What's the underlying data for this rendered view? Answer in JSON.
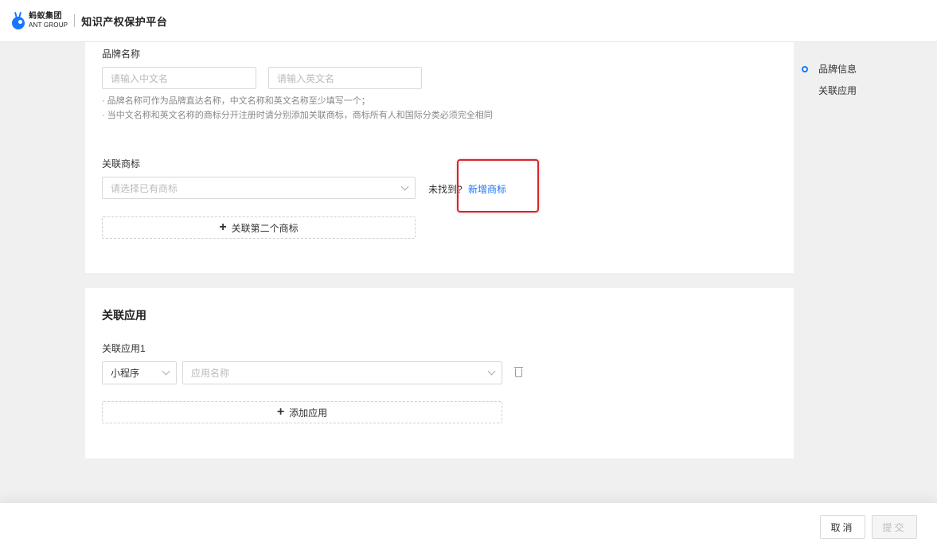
{
  "header": {
    "logo_cn": "蚂蚁集团",
    "logo_en": "ANT GROUP",
    "platform_title": "知识产权保护平台"
  },
  "brand": {
    "label": "品牌名称",
    "cn_placeholder": "请输入中文名",
    "en_placeholder": "请输入英文名",
    "hint1": "· 品牌名称可作为品牌直达名称，中文名称和英文名称至少填写一个；",
    "hint2": "· 当中文名称和英文名称的商标分开注册时请分别添加关联商标，商标所有人和国际分类必须完全相同"
  },
  "trademark": {
    "label": "关联商标",
    "select_placeholder": "请选择已有商标",
    "not_found": "未找到?",
    "add_new": "新增商标",
    "add_second": "关联第二个商标"
  },
  "apps": {
    "section_title": "关联应用",
    "app1_label": "关联应用1",
    "type_value": "小程序",
    "name_placeholder": "应用名称",
    "add_app": "添加应用"
  },
  "anchor": {
    "items": [
      "品牌信息",
      "关联应用"
    ]
  },
  "footer": {
    "cancel": "取消",
    "submit": "提交"
  },
  "colors": {
    "primary": "#1677ff",
    "highlight": "#d6252b"
  }
}
